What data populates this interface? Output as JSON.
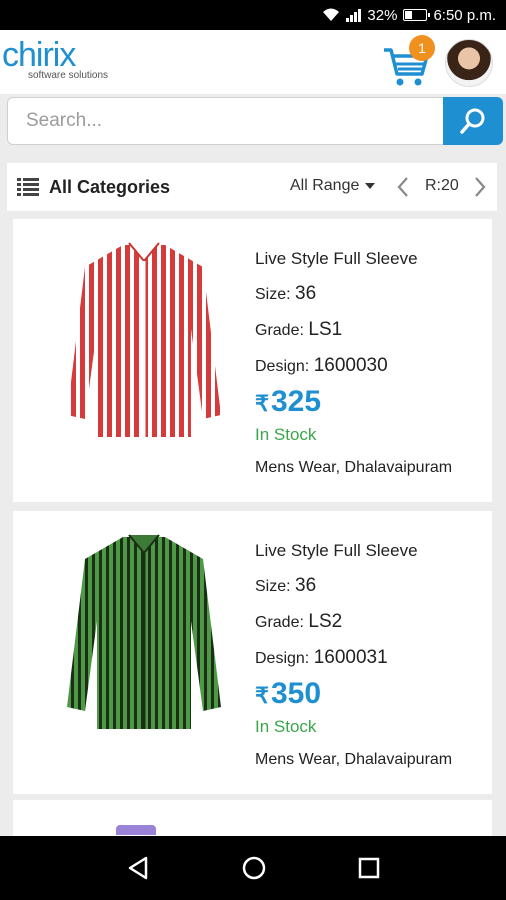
{
  "status": {
    "battery": "32%",
    "time": "6:50 p.m."
  },
  "header": {
    "logo_text": "chirix",
    "logo_tagline": "software solutions",
    "cart_count": "1",
    "brand_color": "#1e8fd0",
    "badge_color": "#f0901e"
  },
  "search": {
    "placeholder": "Search..."
  },
  "filter": {
    "categories_label": "All Categories",
    "range_label": "All Range",
    "page_label": "R:20"
  },
  "products": [
    {
      "title": "Live Style Full Sleeve",
      "size_label": "Size:",
      "size": "36",
      "grade_label": "Grade:",
      "grade": "LS1",
      "design_label": "Design:",
      "design": "1600030",
      "currency": "₹",
      "price": "325",
      "stock": "In Stock",
      "location": "Mens Wear, Dhalavaipuram",
      "shirt_color": "#d63b3b"
    },
    {
      "title": "Live Style Full Sleeve",
      "size_label": "Size:",
      "size": "36",
      "grade_label": "Grade:",
      "grade": "LS2",
      "design_label": "Design:",
      "design": "1600031",
      "currency": "₹",
      "price": "350",
      "stock": "In Stock",
      "location": "Mens Wear, Dhalavaipuram",
      "shirt_color": "#3c7a35"
    }
  ]
}
